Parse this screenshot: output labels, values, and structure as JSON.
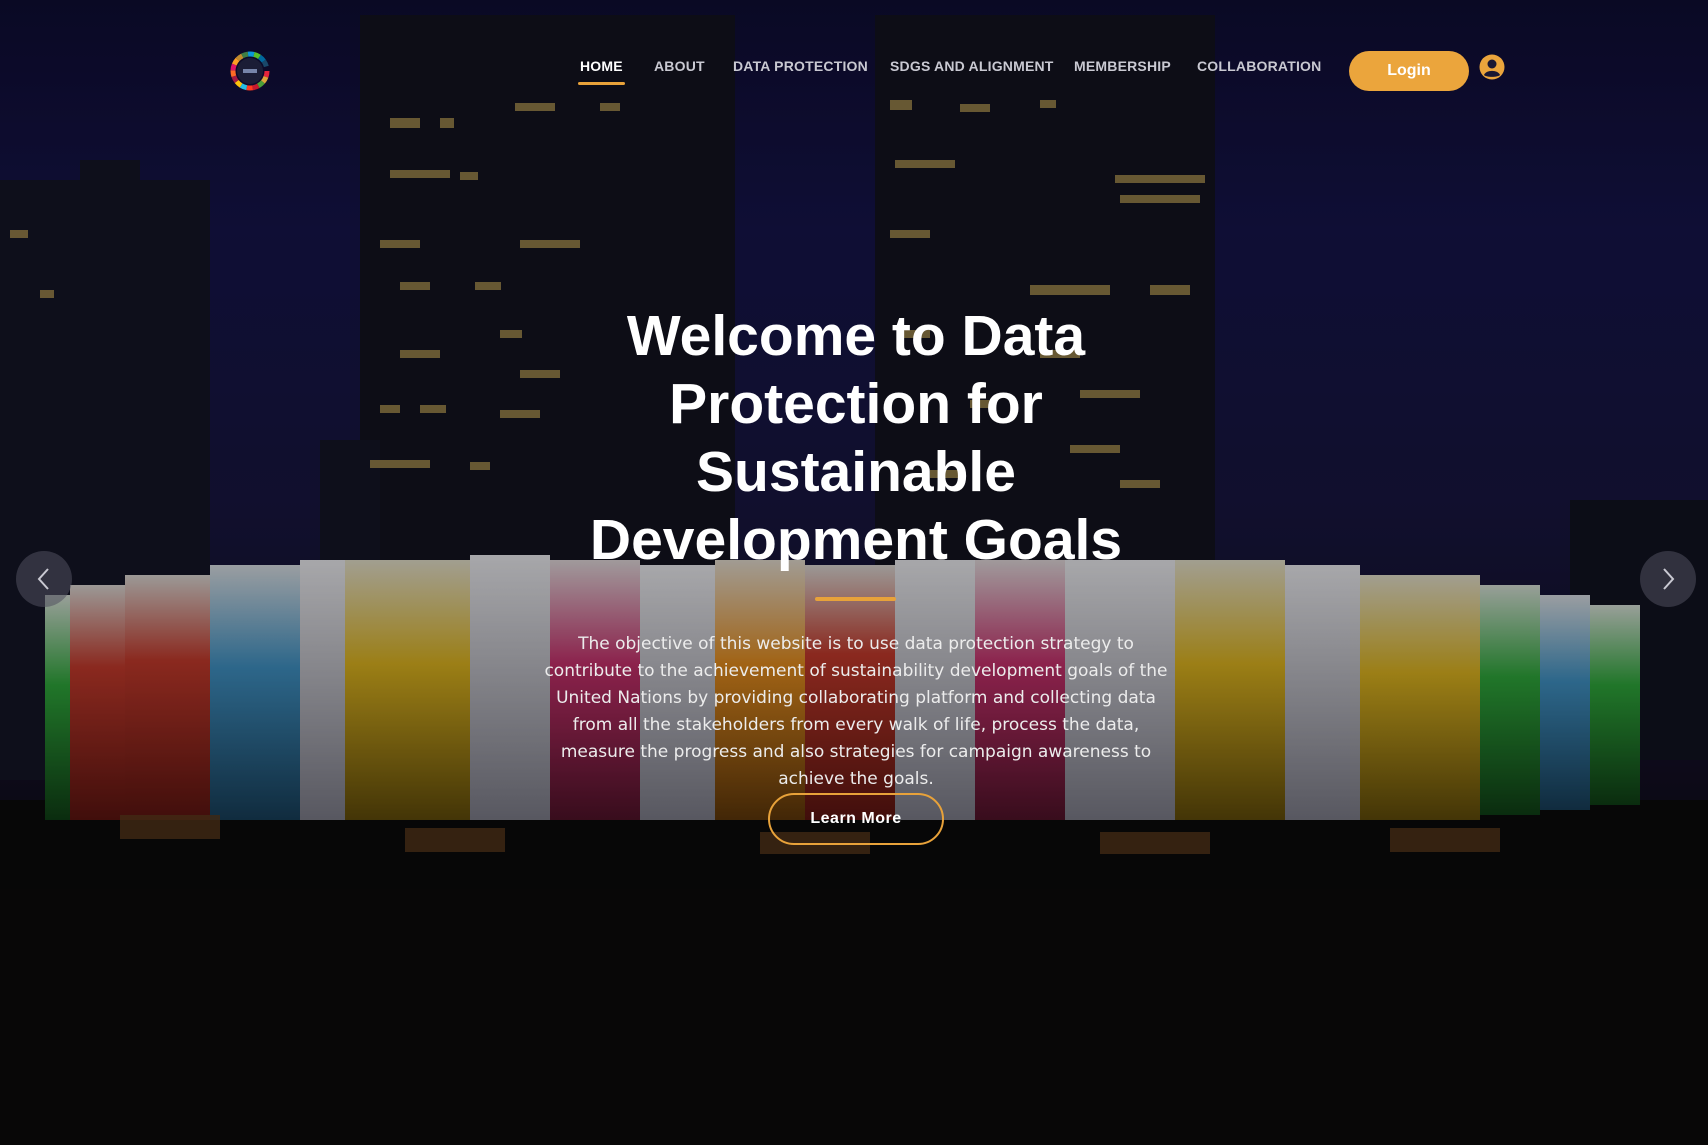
{
  "nav": {
    "items": [
      {
        "label": "HOME",
        "active": true
      },
      {
        "label": "ABOUT",
        "active": false
      },
      {
        "label": "DATA PROTECTION",
        "active": false
      },
      {
        "label": "SDGS AND ALIGNMENT",
        "active": false
      },
      {
        "label": "MEMBERSHIP",
        "active": false
      },
      {
        "label": "COLLABORATION",
        "active": false
      }
    ],
    "login_label": "Login"
  },
  "hero": {
    "title_lines": [
      "Welcome to Data",
      "Protection for",
      "Sustainable",
      "Development Goals"
    ],
    "description": "The objective of this website is to use data protection strategy to contribute to the achievement of sustainability development goals of the United Nations by providing collaborating platform and collecting data from all the stakeholders from every walk of life, process the data, measure the progress and also strategies for campaign awareness to achieve the goals.",
    "cta_label": "Learn More"
  },
  "colors": {
    "accent": "#e8a23a",
    "login_bg": "#eba53c",
    "text": "#ffffff"
  },
  "icons": [
    "sdg-wheel-logo",
    "user-circle-icon",
    "chevron-left-icon",
    "chevron-right-icon"
  ]
}
